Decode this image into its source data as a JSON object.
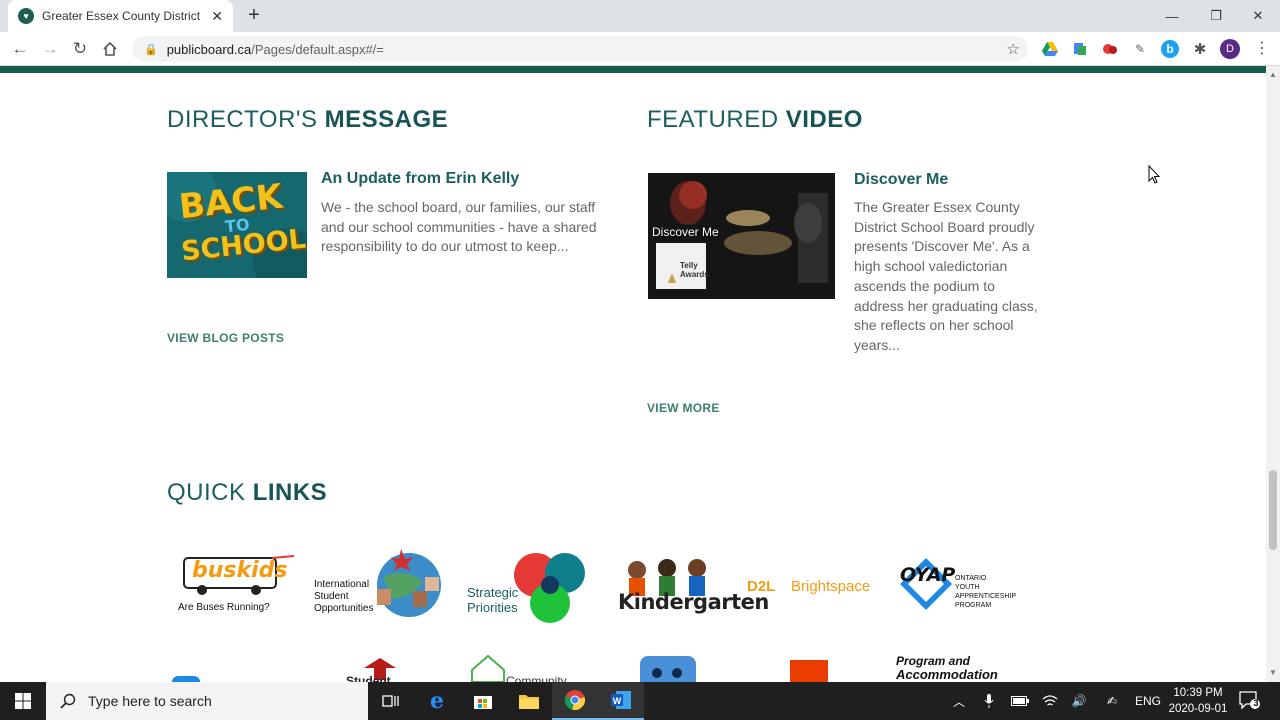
{
  "browser": {
    "tab_title": "Greater Essex County District Sch",
    "tab_close": "✕",
    "new_tab": "+",
    "url_host": "publicboard.ca",
    "url_path": "/Pages/default.aspx#/=",
    "profile_initial": "D"
  },
  "directors_message": {
    "title_light": "DIRECTOR'S ",
    "title_bold": "MESSAGE",
    "post_title": "An Update from Erin Kelly",
    "post_desc_lines": [
      "We - the school board, our families, our staff",
      "and our school communities - have a shared",
      "responsibility to do our utmost to keep..."
    ],
    "image_text_top": "BACK",
    "image_text_mid": "TO",
    "image_text_bottom": "SCHOOL",
    "view_link": "VIEW BLOG POSTS"
  },
  "featured_video": {
    "title_light": "FEATURED ",
    "title_bold": "VIDEO",
    "video_title": "Discover Me",
    "video_desc_lines": [
      "The Greater Essex County",
      "District School Board proudly",
      "presents 'Discover Me'. As a",
      "high school valedictorian",
      "ascends the podium to",
      "address her graduating class,",
      "she reflects on her school",
      "years..."
    ],
    "thumb_caption": "Discover Me",
    "thumb_award": "Telly Awards",
    "view_link": "VIEW MORE"
  },
  "quick_links": {
    "title_light": "QUICK ",
    "title_bold": "LINKS",
    "items": [
      {
        "name": "buskids",
        "logo_text": "buskids",
        "caption": "Are Buses Running?"
      },
      {
        "name": "international",
        "line1": "International",
        "line2": "Student",
        "line3": "Opportunities"
      },
      {
        "name": "strategic",
        "line1": "Strategic",
        "line2": "Priorities"
      },
      {
        "name": "kindergarten",
        "text": "Kindergarten"
      },
      {
        "name": "d2l",
        "brand": "D2L",
        "text": "Brightspace"
      },
      {
        "name": "oyap",
        "logo": "OYAP",
        "line1": "ONTARIO",
        "line2": "YOUTH",
        "line3": "APPRENTICESHIP",
        "line4": "PROGRAM"
      }
    ],
    "row2": {
      "student": "Student",
      "community": "Community",
      "program_line1": "Program and",
      "program_line2": "Accommodation"
    }
  },
  "taskbar": {
    "search_placeholder": "Type here to search",
    "lang": "ENG",
    "time": "10:39 PM",
    "date": "2020-09-01",
    "notif_count": "3"
  },
  "colors": {
    "brand_green": "#185a50",
    "heading_teal": "#1d5e5e",
    "link_green": "#3d7f6f"
  }
}
